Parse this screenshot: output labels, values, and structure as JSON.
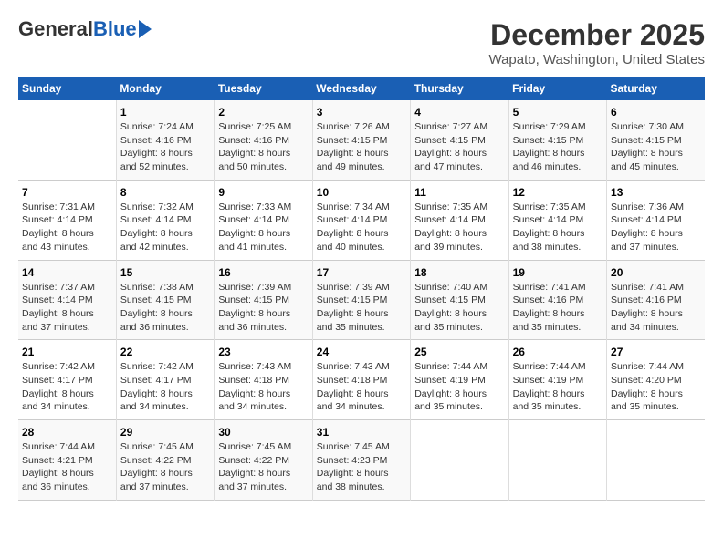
{
  "header": {
    "logo_general": "General",
    "logo_blue": "Blue",
    "month_title": "December 2025",
    "location": "Wapato, Washington, United States"
  },
  "days_of_week": [
    "Sunday",
    "Monday",
    "Tuesday",
    "Wednesday",
    "Thursday",
    "Friday",
    "Saturday"
  ],
  "weeks": [
    [
      {
        "day": "",
        "info": ""
      },
      {
        "day": "1",
        "info": "Sunrise: 7:24 AM\nSunset: 4:16 PM\nDaylight: 8 hours\nand 52 minutes."
      },
      {
        "day": "2",
        "info": "Sunrise: 7:25 AM\nSunset: 4:16 PM\nDaylight: 8 hours\nand 50 minutes."
      },
      {
        "day": "3",
        "info": "Sunrise: 7:26 AM\nSunset: 4:15 PM\nDaylight: 8 hours\nand 49 minutes."
      },
      {
        "day": "4",
        "info": "Sunrise: 7:27 AM\nSunset: 4:15 PM\nDaylight: 8 hours\nand 47 minutes."
      },
      {
        "day": "5",
        "info": "Sunrise: 7:29 AM\nSunset: 4:15 PM\nDaylight: 8 hours\nand 46 minutes."
      },
      {
        "day": "6",
        "info": "Sunrise: 7:30 AM\nSunset: 4:15 PM\nDaylight: 8 hours\nand 45 minutes."
      }
    ],
    [
      {
        "day": "7",
        "info": "Sunrise: 7:31 AM\nSunset: 4:14 PM\nDaylight: 8 hours\nand 43 minutes."
      },
      {
        "day": "8",
        "info": "Sunrise: 7:32 AM\nSunset: 4:14 PM\nDaylight: 8 hours\nand 42 minutes."
      },
      {
        "day": "9",
        "info": "Sunrise: 7:33 AM\nSunset: 4:14 PM\nDaylight: 8 hours\nand 41 minutes."
      },
      {
        "day": "10",
        "info": "Sunrise: 7:34 AM\nSunset: 4:14 PM\nDaylight: 8 hours\nand 40 minutes."
      },
      {
        "day": "11",
        "info": "Sunrise: 7:35 AM\nSunset: 4:14 PM\nDaylight: 8 hours\nand 39 minutes."
      },
      {
        "day": "12",
        "info": "Sunrise: 7:35 AM\nSunset: 4:14 PM\nDaylight: 8 hours\nand 38 minutes."
      },
      {
        "day": "13",
        "info": "Sunrise: 7:36 AM\nSunset: 4:14 PM\nDaylight: 8 hours\nand 37 minutes."
      }
    ],
    [
      {
        "day": "14",
        "info": "Sunrise: 7:37 AM\nSunset: 4:14 PM\nDaylight: 8 hours\nand 37 minutes."
      },
      {
        "day": "15",
        "info": "Sunrise: 7:38 AM\nSunset: 4:15 PM\nDaylight: 8 hours\nand 36 minutes."
      },
      {
        "day": "16",
        "info": "Sunrise: 7:39 AM\nSunset: 4:15 PM\nDaylight: 8 hours\nand 36 minutes."
      },
      {
        "day": "17",
        "info": "Sunrise: 7:39 AM\nSunset: 4:15 PM\nDaylight: 8 hours\nand 35 minutes."
      },
      {
        "day": "18",
        "info": "Sunrise: 7:40 AM\nSunset: 4:15 PM\nDaylight: 8 hours\nand 35 minutes."
      },
      {
        "day": "19",
        "info": "Sunrise: 7:41 AM\nSunset: 4:16 PM\nDaylight: 8 hours\nand 35 minutes."
      },
      {
        "day": "20",
        "info": "Sunrise: 7:41 AM\nSunset: 4:16 PM\nDaylight: 8 hours\nand 34 minutes."
      }
    ],
    [
      {
        "day": "21",
        "info": "Sunrise: 7:42 AM\nSunset: 4:17 PM\nDaylight: 8 hours\nand 34 minutes."
      },
      {
        "day": "22",
        "info": "Sunrise: 7:42 AM\nSunset: 4:17 PM\nDaylight: 8 hours\nand 34 minutes."
      },
      {
        "day": "23",
        "info": "Sunrise: 7:43 AM\nSunset: 4:18 PM\nDaylight: 8 hours\nand 34 minutes."
      },
      {
        "day": "24",
        "info": "Sunrise: 7:43 AM\nSunset: 4:18 PM\nDaylight: 8 hours\nand 34 minutes."
      },
      {
        "day": "25",
        "info": "Sunrise: 7:44 AM\nSunset: 4:19 PM\nDaylight: 8 hours\nand 35 minutes."
      },
      {
        "day": "26",
        "info": "Sunrise: 7:44 AM\nSunset: 4:19 PM\nDaylight: 8 hours\nand 35 minutes."
      },
      {
        "day": "27",
        "info": "Sunrise: 7:44 AM\nSunset: 4:20 PM\nDaylight: 8 hours\nand 35 minutes."
      }
    ],
    [
      {
        "day": "28",
        "info": "Sunrise: 7:44 AM\nSunset: 4:21 PM\nDaylight: 8 hours\nand 36 minutes."
      },
      {
        "day": "29",
        "info": "Sunrise: 7:45 AM\nSunset: 4:22 PM\nDaylight: 8 hours\nand 37 minutes."
      },
      {
        "day": "30",
        "info": "Sunrise: 7:45 AM\nSunset: 4:22 PM\nDaylight: 8 hours\nand 37 minutes."
      },
      {
        "day": "31",
        "info": "Sunrise: 7:45 AM\nSunset: 4:23 PM\nDaylight: 8 hours\nand 38 minutes."
      },
      {
        "day": "",
        "info": ""
      },
      {
        "day": "",
        "info": ""
      },
      {
        "day": "",
        "info": ""
      }
    ]
  ]
}
